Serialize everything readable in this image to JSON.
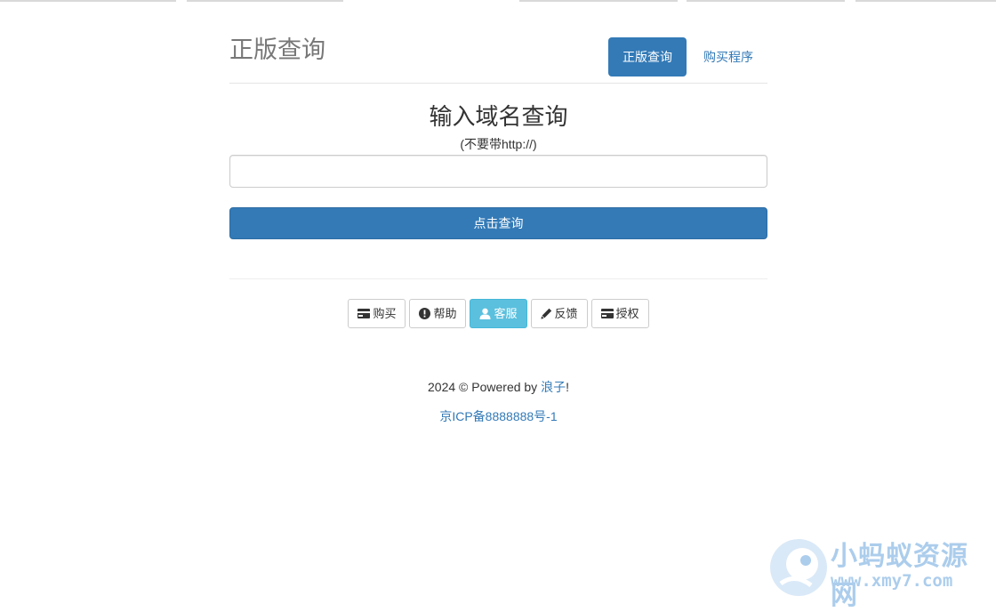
{
  "header": {
    "brand": "正版查询",
    "nav": [
      {
        "label": "正版查询",
        "active": true
      },
      {
        "label": "购买程序",
        "active": false
      }
    ]
  },
  "main": {
    "heading": "输入域名查询",
    "hint": "(不要带http://)",
    "input": {
      "value": "",
      "placeholder": ""
    },
    "submit_label": "点击查询"
  },
  "actions": [
    {
      "label": "购买",
      "icon": "credit-card-icon"
    },
    {
      "label": "帮助",
      "icon": "exclamation-circle-icon"
    },
    {
      "label": "客服",
      "icon": "user-icon"
    },
    {
      "label": "反馈",
      "icon": "pencil-icon"
    },
    {
      "label": "授权",
      "icon": "credit-card-icon"
    }
  ],
  "footer": {
    "copyright_prefix": "2024 © Powered by ",
    "author": "浪子",
    "copyright_suffix": "!",
    "icp": "京ICP备8888888号-1"
  },
  "watermark": {
    "title": "小蚂蚁资源网",
    "url": "www.xmy7.com"
  },
  "colors": {
    "primary": "#337ab7",
    "info": "#5bc0de",
    "brand_text": "#777777",
    "watermark": "#6aa6de"
  }
}
